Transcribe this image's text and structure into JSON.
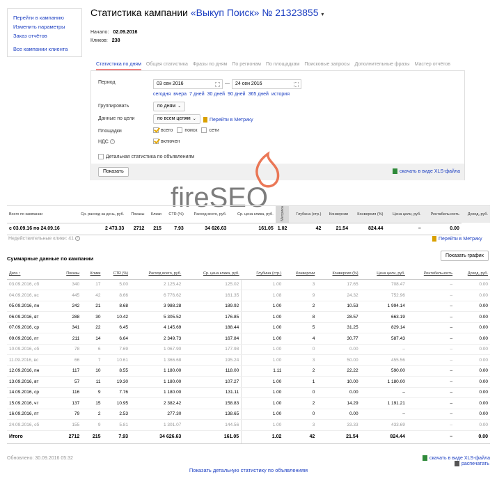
{
  "nav": {
    "items": [
      "Перейти в кампанию",
      "Изменить параметры",
      "Заказ отчётов"
    ],
    "all_campaigns": "Все кампании клиента"
  },
  "header": {
    "title_prefix": "Статистика кампании",
    "campaign": "«Выкуп Поиск» № 21323855",
    "caret": "▾",
    "start_label": "Начало:",
    "start_value": "02.09.2016",
    "clicks_label": "Кликов:",
    "clicks_value": "238"
  },
  "tabs": [
    {
      "label": "Статистика по дням",
      "active": true
    },
    {
      "label": "Общая статистика"
    },
    {
      "label": "Фразы по дням"
    },
    {
      "label": "По регионам"
    },
    {
      "label": "По площадкам"
    },
    {
      "label": "Поисковые запросы"
    },
    {
      "label": "Дополнительные фразы"
    },
    {
      "label": "Мастер отчётов"
    }
  ],
  "filter": {
    "period_label": "Период",
    "date_from": "03 сен 2016",
    "date_dash": "—",
    "date_to": "24 сен 2016",
    "quick_links": [
      "сегодня",
      "вчера",
      "7 дней",
      "30 дней",
      "90 дней",
      "365 дней",
      "история"
    ],
    "group_label": "Группировать",
    "group_value": "по дням",
    "goal_label": "Данные по цели",
    "goal_value": "по всем целям",
    "metrika_link": "Перейти в Метрику",
    "platforms_label": "Площадки",
    "platforms": [
      {
        "label": "всего",
        "checked": true
      },
      {
        "label": "поиск",
        "checked": false
      },
      {
        "label": "сети",
        "checked": false
      }
    ],
    "vat_label": "НДС",
    "vat_value": "включен",
    "detailed_label": "Детальная статистика по объявлениям",
    "show_button": "Показать",
    "xls_link": "скачать в виде XLS-файла"
  },
  "watermark": "fireSEO",
  "summary": {
    "headers": [
      "Всего по кампании",
      "Ср. расход за день, руб.",
      "Показы",
      "Клики",
      "CTR (%)",
      "Расход всего, руб.",
      "Ср. цена клика, руб.",
      "Метрика",
      "Глубина (стр.)",
      "Конверсии",
      "Конверсия (%)",
      "Цена цели, руб.",
      "Рентабельность",
      "Доход, руб."
    ],
    "row": [
      "с 03.09.16 по 24.09.16",
      "2 473.33",
      "2712",
      "215",
      "7.93",
      "34 626.63",
      "161.05",
      "",
      "1.02",
      "42",
      "21.54",
      "824.44",
      "–",
      "0.00"
    ]
  },
  "invalid_clicks": "Недействительные клики: 41",
  "metrika_link2": "Перейти в Метрику",
  "daily": {
    "title": "Суммарные данные по кампании",
    "show_chart": "Показать график",
    "headers": [
      "Дата ↑",
      "Показы",
      "Клики",
      "CTR (%)",
      "Расход всего, руб.",
      "Ср. цена клика, руб.",
      "Глубина (стр.)",
      "Конверсии",
      "Конверсия (%)",
      "Цена цели, руб.",
      "Рентабельность",
      "Доход, руб."
    ],
    "rows": [
      {
        "w": true,
        "c": [
          "03.09.2016, сб",
          "340",
          "17",
          "5.00",
          "2 125.42",
          "125.02",
          "1.00",
          "3",
          "17.65",
          "708.47",
          "–",
          "0.00"
        ]
      },
      {
        "w": true,
        "c": [
          "04.09.2016, вс",
          "445",
          "42",
          "8.66",
          "6 776.62",
          "161.35",
          "1.08",
          "9",
          "24.32",
          "752.96",
          "–",
          "0.00"
        ]
      },
      {
        "w": false,
        "c": [
          "05.09.2016, пн",
          "242",
          "21",
          "8.68",
          "3 988.28",
          "189.92",
          "1.00",
          "2",
          "10.53",
          "1 994.14",
          "–",
          "0.00"
        ]
      },
      {
        "w": false,
        "c": [
          "06.09.2016, вт",
          "288",
          "30",
          "10.42",
          "5 305.52",
          "176.85",
          "1.00",
          "8",
          "28.57",
          "663.19",
          "–",
          "0.00"
        ]
      },
      {
        "w": false,
        "c": [
          "07.09.2016, ср",
          "341",
          "22",
          "6.45",
          "4 145.69",
          "188.44",
          "1.00",
          "5",
          "31.25",
          "829.14",
          "–",
          "0.00"
        ]
      },
      {
        "w": false,
        "c": [
          "09.09.2016, пт",
          "211",
          "14",
          "6.64",
          "2 349.73",
          "167.84",
          "1.00",
          "4",
          "30.77",
          "587.43",
          "–",
          "0.00"
        ]
      },
      {
        "w": true,
        "c": [
          "10.09.2016, сб",
          "78",
          "6",
          "7.69",
          "1 067.90",
          "177.98",
          "1.00",
          "0",
          "0.00",
          "–",
          "–",
          "0.00"
        ]
      },
      {
        "w": true,
        "c": [
          "11.09.2016, вс",
          "66",
          "7",
          "10.61",
          "1 366.68",
          "195.24",
          "1.00",
          "3",
          "50.00",
          "455.56",
          "–",
          "0.00"
        ]
      },
      {
        "w": false,
        "c": [
          "12.09.2016, пн",
          "117",
          "10",
          "8.55",
          "1 180.00",
          "118.00",
          "1.11",
          "2",
          "22.22",
          "590.00",
          "–",
          "0.00"
        ]
      },
      {
        "w": false,
        "c": [
          "13.09.2016, вт",
          "57",
          "11",
          "19.30",
          "1 180.00",
          "107.27",
          "1.00",
          "1",
          "10.00",
          "1 180.00",
          "–",
          "0.00"
        ]
      },
      {
        "w": false,
        "c": [
          "14.09.2016, ср",
          "116",
          "9",
          "7.76",
          "1 180.00",
          "131.11",
          "1.00",
          "0",
          "0.00",
          "–",
          "–",
          "0.00"
        ]
      },
      {
        "w": false,
        "c": [
          "15.09.2016, чт",
          "137",
          "15",
          "10.95",
          "2 382.42",
          "158.83",
          "1.00",
          "2",
          "14.29",
          "1 191.21",
          "–",
          "0.00"
        ]
      },
      {
        "w": false,
        "c": [
          "16.09.2016, пт",
          "79",
          "2",
          "2.53",
          "277.30",
          "138.65",
          "1.00",
          "0",
          "0.00",
          "–",
          "–",
          "0.00"
        ]
      },
      {
        "w": true,
        "c": [
          "24.09.2016, сб",
          "155",
          "9",
          "5.81",
          "1 301.07",
          "144.56",
          "1.00",
          "3",
          "33.33",
          "433.69",
          "–",
          "0.00"
        ]
      }
    ],
    "total": [
      "Итого",
      "2712",
      "215",
      "7.93",
      "34 626.63",
      "161.05",
      "1.02",
      "42",
      "21.54",
      "824.44",
      "–",
      "0.00"
    ]
  },
  "footer": {
    "updated": "Обновлено: 30.09.2016 05:32",
    "xls": "скачать в виде XLS-файла",
    "print": "распечатать",
    "detailed": "Показать детальную статистику по объявлениям"
  }
}
